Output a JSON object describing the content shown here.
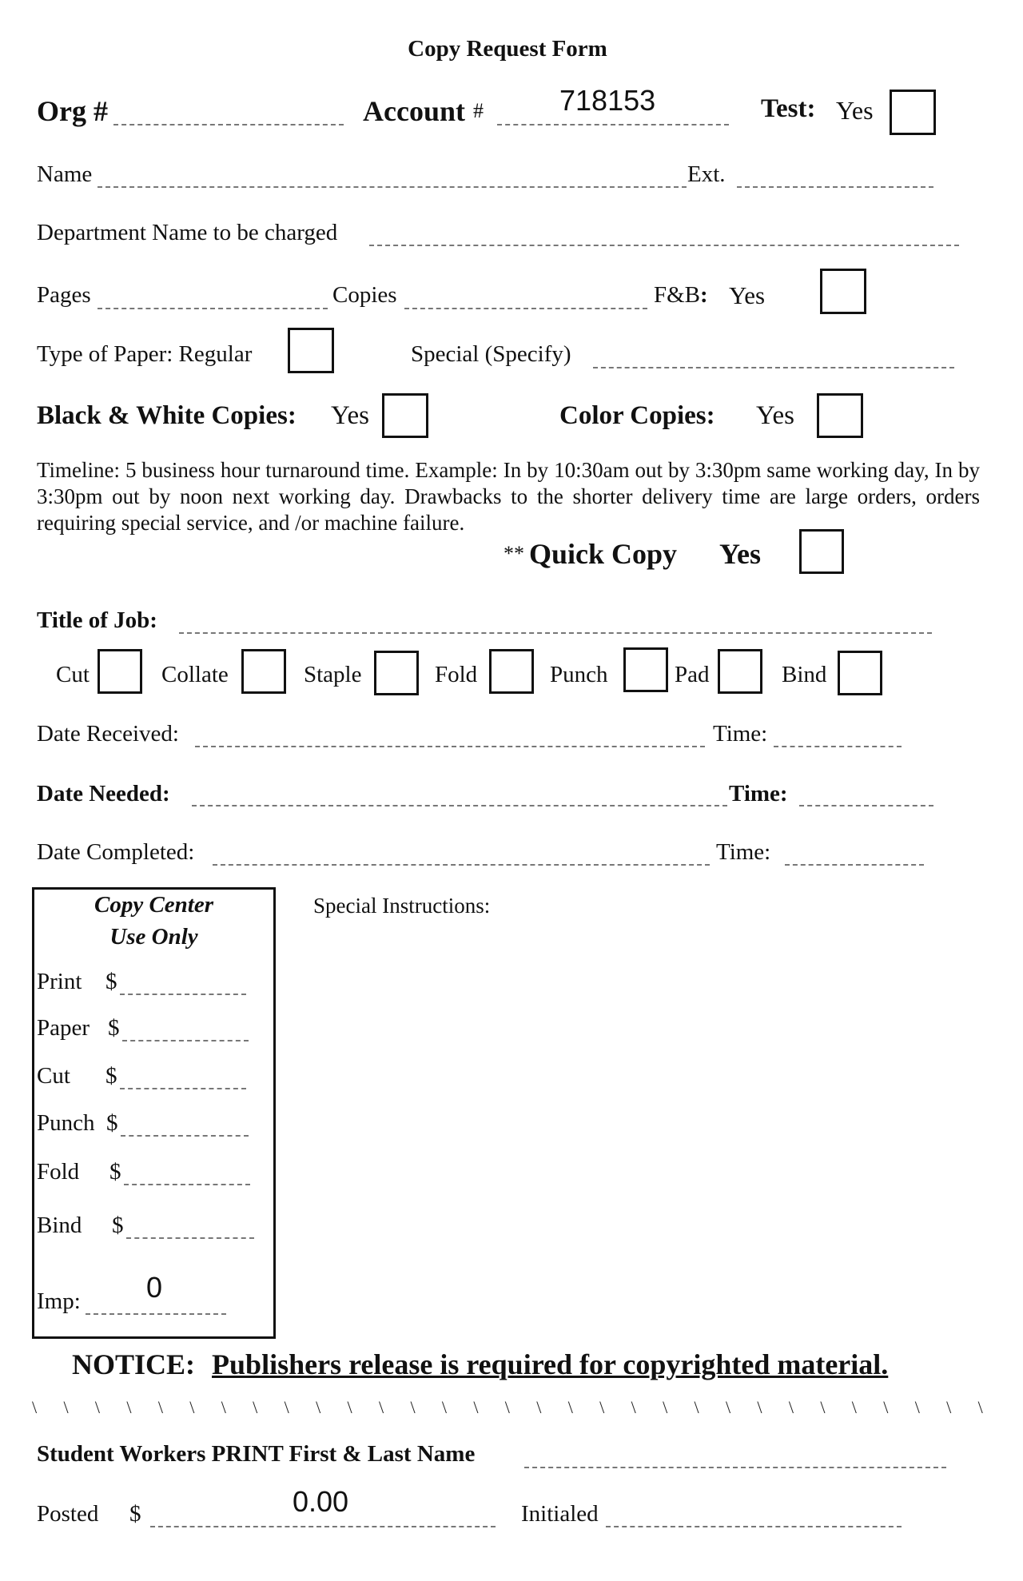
{
  "title": "Copy Request Form",
  "header": {
    "org_label": "Org #",
    "org_value": "",
    "account_label": "Account",
    "account_hash": "#",
    "account_value": "718153",
    "test_label": "Test:",
    "test_yes": "Yes",
    "test_checked": false
  },
  "fields": {
    "name_label": "Name",
    "ext_label": "Ext.",
    "department_label": "Department Name to be charged",
    "pages_label": "Pages",
    "copies_label": "Copies",
    "fb_label": "F&B",
    "fb_colon": ":",
    "fb_yes": "Yes",
    "paper_type_label": "Type of Paper:  Regular",
    "special_label": "Special (Specify)",
    "bw_label": "Black & White Copies:",
    "bw_yes": "Yes",
    "color_label": "Color Copies:",
    "color_yes": "Yes"
  },
  "timeline_text": "Timeline: 5 business hour turnaround time.  Example: In by 10:30am out by 3:30pm same working day, In by 3:30pm out by noon next working day.  Drawbacks to the shorter delivery time are large orders, orders requiring special service, and /or machine failure.",
  "quick_copy": {
    "prefix": "**",
    "label": "Quick Copy",
    "yes": "Yes"
  },
  "job": {
    "title_label": "Title of Job:",
    "finishing_options": [
      "Cut",
      "Collate",
      "Staple",
      "Fold",
      "Punch",
      "Pad",
      "Bind"
    ]
  },
  "dates": {
    "received_label": "Date Received:",
    "received_time_label": "Time:",
    "needed_label": "Date Needed:",
    "needed_time_label": "Time:",
    "completed_label": "Date Completed:",
    "completed_time_label": "Time:"
  },
  "copy_center": {
    "heading_line1": "Copy Center",
    "heading_line2": "Use Only",
    "rows": [
      {
        "label": "Print",
        "currency": "$"
      },
      {
        "label": "Paper",
        "currency": "$"
      },
      {
        "label": "Cut",
        "currency": "$"
      },
      {
        "label": "Punch",
        "currency": "$"
      },
      {
        "label": "Fold",
        "currency": "$"
      },
      {
        "label": "Bind",
        "currency": "$"
      }
    ],
    "imp_label": "Imp:",
    "imp_value": "0"
  },
  "special_instructions_label": "Special Instructions:",
  "notice": {
    "label": "NOTICE:",
    "text": "Publishers release is required for copyrighted material."
  },
  "footer": {
    "student_label": "Student Workers PRINT First & Last Name",
    "posted_label": "Posted",
    "posted_currency": "$",
    "posted_value": "0.00",
    "initialed_label": "Initialed"
  }
}
